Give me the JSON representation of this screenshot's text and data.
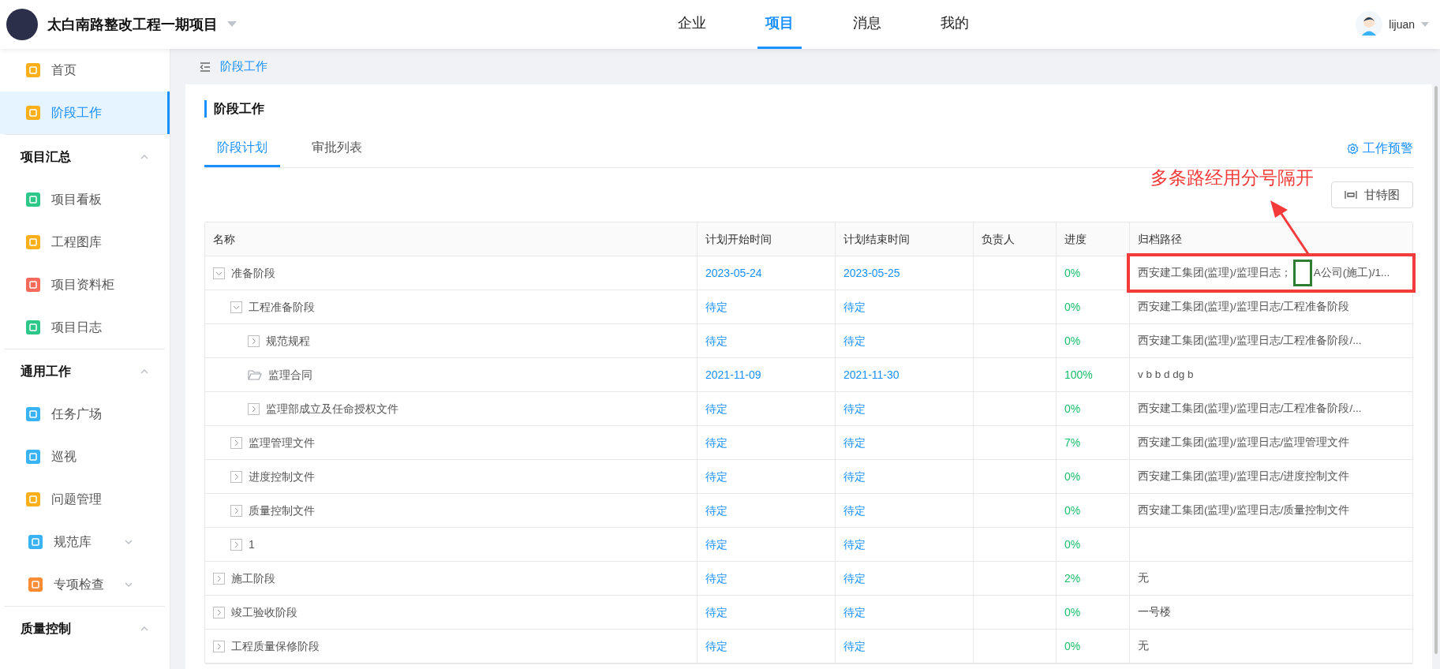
{
  "header": {
    "project_title": "太白南路整改工程一期项目",
    "nav": [
      {
        "label": "企业",
        "selected": false
      },
      {
        "label": "项目",
        "selected": true
      },
      {
        "label": "消息",
        "selected": false
      },
      {
        "label": "我的",
        "selected": false
      }
    ],
    "user": "lijuan"
  },
  "sidebar": {
    "items": [
      {
        "kind": "item",
        "label": "首页",
        "color": "#fbb01b",
        "selected": false
      },
      {
        "kind": "item",
        "label": "阶段工作",
        "color": "#fbb01b",
        "selected": true
      },
      {
        "kind": "section",
        "label": "项目汇总",
        "expanded": true
      },
      {
        "kind": "item",
        "label": "项目看板",
        "color": "#2dc78a",
        "selected": false
      },
      {
        "kind": "item",
        "label": "工程图库",
        "color": "#fbb01b",
        "selected": false
      },
      {
        "kind": "item",
        "label": "项目资料柜",
        "color": "#f56a5b",
        "selected": false
      },
      {
        "kind": "item",
        "label": "项目日志",
        "color": "#2dc78a",
        "selected": false
      },
      {
        "kind": "section",
        "label": "通用工作",
        "expanded": true
      },
      {
        "kind": "item",
        "label": "任务广场",
        "color": "#3ab3f5",
        "selected": false
      },
      {
        "kind": "item",
        "label": "巡视",
        "color": "#3ab3f5",
        "selected": false
      },
      {
        "kind": "item",
        "label": "问题管理",
        "color": "#fbb01b",
        "selected": false
      },
      {
        "kind": "submenu",
        "label": "规范库",
        "color": "#3ab3f5",
        "expanded": false
      },
      {
        "kind": "submenu",
        "label": "专项检查",
        "color": "#fa8c35",
        "expanded": false
      },
      {
        "kind": "section",
        "label": "质量控制",
        "expanded": true
      }
    ]
  },
  "breadcrumb": "阶段工作",
  "panel": {
    "title": "阶段工作",
    "tabs": [
      {
        "label": "阶段计划",
        "selected": true
      },
      {
        "label": "审批列表",
        "selected": false
      }
    ],
    "warning_link": "工作预警",
    "gantt_button": "甘特图"
  },
  "annotation": {
    "note": "多条路经用分号隔开"
  },
  "table": {
    "columns": [
      "名称",
      "计划开始时间",
      "计划结束时间",
      "负责人",
      "进度",
      "归档路径"
    ],
    "rows": [
      {
        "kind": "group",
        "name": "准备阶段",
        "expanded": true,
        "start": "2023-05-24",
        "end": "2023-05-25",
        "progress": "0%",
        "highlighted": true,
        "paths": [
          "西安建工集团(监理)/监理日志；",
          "A公司(施工)/1..."
        ],
        "children": [
          {
            "kind": "group",
            "name": "工程准备阶段",
            "expanded": true,
            "start": "待定",
            "end": "待定",
            "progress": "0%",
            "path": "西安建工集团(监理)/监理日志/工程准备阶段",
            "children": [
              {
                "kind": "group",
                "name": "规范规程",
                "expanded": false,
                "start": "待定",
                "end": "待定",
                "progress": "0%",
                "path": "西安建工集团(监理)/监理日志/工程准备阶段/..."
              },
              {
                "kind": "folder",
                "name": "监理合同",
                "start": "2021-11-09",
                "end": "2021-11-30",
                "progress": "100%",
                "path": "v b b d dg b"
              },
              {
                "kind": "group",
                "name": "监理部成立及任命授权文件",
                "expanded": false,
                "start": "待定",
                "end": "待定",
                "progress": "0%",
                "path": "西安建工集团(监理)/监理日志/工程准备阶段/..."
              }
            ]
          },
          {
            "kind": "group",
            "name": "监理管理文件",
            "expanded": false,
            "start": "待定",
            "end": "待定",
            "progress": "7%",
            "path": "西安建工集团(监理)/监理日志/监理管理文件"
          },
          {
            "kind": "group",
            "name": "进度控制文件",
            "expanded": false,
            "start": "待定",
            "end": "待定",
            "progress": "0%",
            "path": "西安建工集团(监理)/监理日志/进度控制文件"
          },
          {
            "kind": "group",
            "name": "质量控制文件",
            "expanded": false,
            "start": "待定",
            "end": "待定",
            "progress": "0%",
            "path": "西安建工集团(监理)/监理日志/质量控制文件"
          },
          {
            "kind": "group",
            "name": "1",
            "expanded": false,
            "start": "待定",
            "end": "待定",
            "progress": "0%"
          }
        ]
      },
      {
        "kind": "group",
        "name": "施工阶段",
        "expanded": false,
        "start": "待定",
        "end": "待定",
        "progress": "2%",
        "path": "无"
      },
      {
        "kind": "group",
        "name": "竣工验收阶段",
        "expanded": false,
        "start": "待定",
        "end": "待定",
        "progress": "0%",
        "path": "一号楼"
      },
      {
        "kind": "group",
        "name": "工程质量保修阶段",
        "expanded": false,
        "start": "待定",
        "end": "待定",
        "progress": "0%",
        "path": "无"
      }
    ]
  }
}
